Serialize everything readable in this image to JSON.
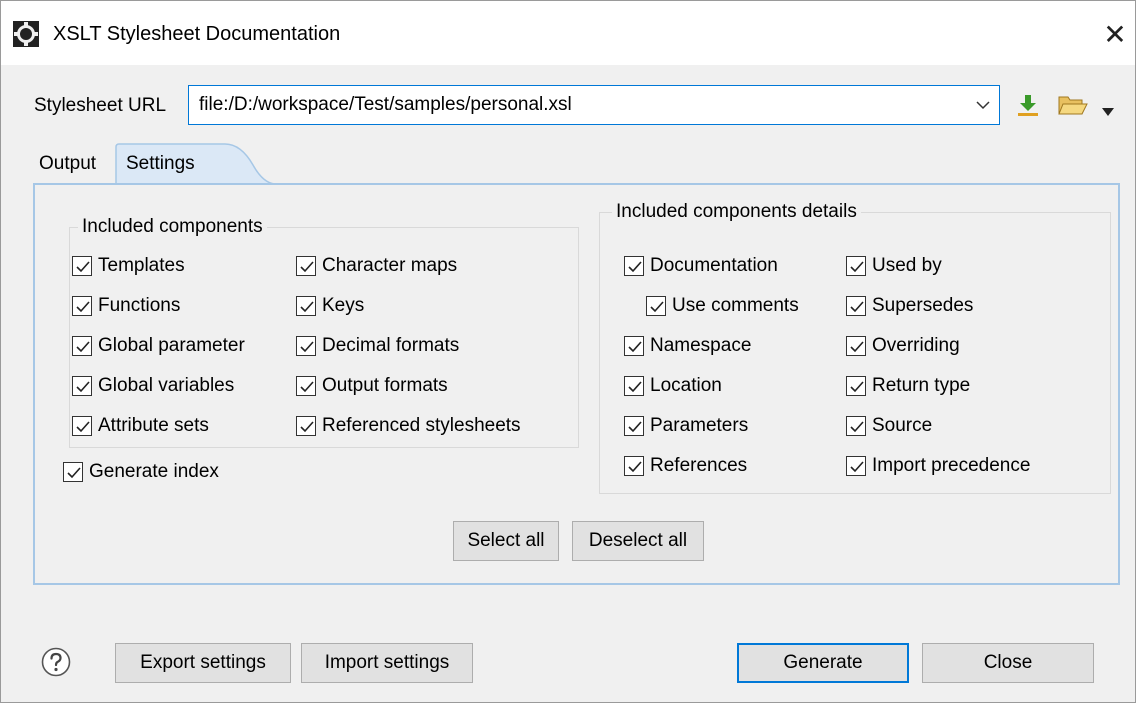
{
  "window": {
    "title": "XSLT Stylesheet Documentation",
    "close_glyph": "✕"
  },
  "url": {
    "label": "Stylesheet URL",
    "value": "file:/D:/workspace/Test/samples/personal.xsl"
  },
  "tabs": [
    {
      "label": "Output",
      "selected": false
    },
    {
      "label": "Settings",
      "selected": true
    }
  ],
  "components": {
    "title": "Included components",
    "items": [
      {
        "label": "Templates",
        "checked": true
      },
      {
        "label": "Functions",
        "checked": true
      },
      {
        "label": "Global parameter",
        "checked": true
      },
      {
        "label": "Global variables",
        "checked": true
      },
      {
        "label": "Attribute sets",
        "checked": true
      },
      {
        "label": "Character maps",
        "checked": true
      },
      {
        "label": "Keys",
        "checked": true
      },
      {
        "label": "Decimal formats",
        "checked": true
      },
      {
        "label": "Output formats",
        "checked": true
      },
      {
        "label": "Referenced stylesheets",
        "checked": true
      }
    ]
  },
  "generate_index": {
    "label": "Generate index",
    "checked": true
  },
  "details": {
    "title": "Included components details",
    "items": [
      {
        "label": "Documentation",
        "checked": true
      },
      {
        "label": "Use comments",
        "checked": true
      },
      {
        "label": "Namespace",
        "checked": true
      },
      {
        "label": "Location",
        "checked": true
      },
      {
        "label": "Parameters",
        "checked": true
      },
      {
        "label": "References",
        "checked": true
      },
      {
        "label": "Used by",
        "checked": true
      },
      {
        "label": "Supersedes",
        "checked": true
      },
      {
        "label": "Overriding",
        "checked": true
      },
      {
        "label": "Return type",
        "checked": true
      },
      {
        "label": "Source",
        "checked": true
      },
      {
        "label": "Import precedence",
        "checked": true
      }
    ]
  },
  "buttons": {
    "select_all": "Select all",
    "deselect_all": "Deselect all",
    "export_settings": "Export settings",
    "import_settings": "Import settings",
    "generate": "Generate",
    "close": "Close"
  },
  "colors": {
    "accent": "#0078d7",
    "tab_selected": "#dbe8f6",
    "panel_border": "#a6c7e6"
  },
  "icons": {
    "app": "oxygen-app-icon",
    "download": "download-arrow-icon",
    "browse": "folder-open-icon",
    "help": "help-question-icon"
  }
}
